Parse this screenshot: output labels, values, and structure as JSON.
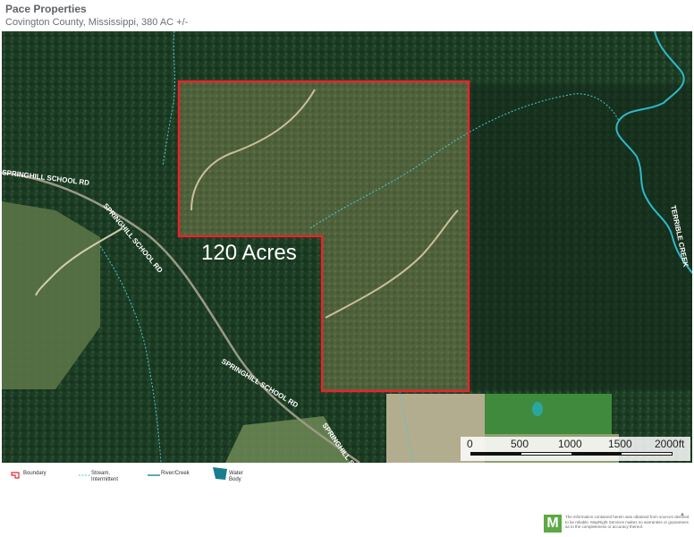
{
  "header": {
    "title": "Pace Properties",
    "subtitle": "Covington County, Mississippi, 380 AC +/-"
  },
  "map": {
    "parcel_label": "120 Acres",
    "road_labels": [
      "SPRINGHILL SCHOOL RD",
      "SPRINGHILL SCHOOL RD",
      "SPRINGHILL SCHOOL RD",
      "SPRINGHILL S"
    ],
    "creek_label": "TERRIBLE CREEK",
    "colors": {
      "boundary": "#e8242b",
      "stream": "#4ec7d2",
      "river": "#2fb9c6",
      "water_body": "#1a7d8f",
      "forest": "#1b3a22",
      "clearing": "#7a8a5a"
    }
  },
  "scale": {
    "ticks": [
      "0",
      "500",
      "1000",
      "1500",
      "2000ft"
    ]
  },
  "legend": {
    "items": [
      {
        "icon": "boundary-icon",
        "label": "Boundary"
      },
      {
        "icon": "stream-intermittent-icon",
        "label": "Stream,\nIntermittent"
      },
      {
        "icon": "river-creek-icon",
        "label": "River/Creek"
      },
      {
        "icon": "water-body-icon",
        "label": "Water Body"
      }
    ]
  },
  "footer": {
    "logo_letter": "M",
    "disclaimer": "The information contained herein was obtained from sources deemed to be reliable. MapRight Services makes no warranties or guarantees as to the completeness or accuracy thereof."
  }
}
